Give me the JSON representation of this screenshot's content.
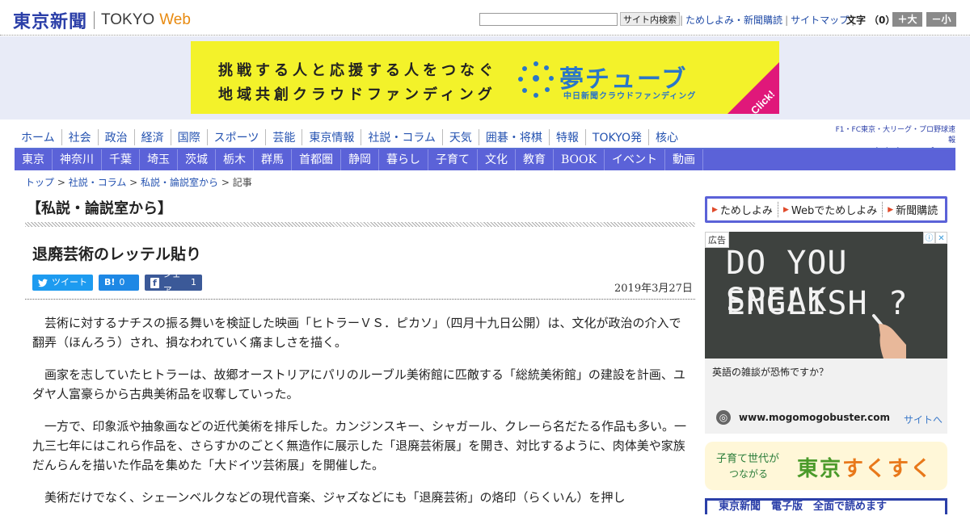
{
  "header": {
    "logo_jp": "東京新聞",
    "logo_en": "TOKYO",
    "logo_web": "Web",
    "search_button": "サイト内検索",
    "links": [
      "ためしよみ・新聞購読",
      "サイトマップ"
    ],
    "fontsize_label": "文字",
    "fontsize_count": "（0）",
    "enlarge": "＋大",
    "shrink": "－小"
  },
  "banner": {
    "line1": "挑戦する人と応援する人をつなぐ",
    "line2": "地域共創クラウドファンディング",
    "title": "夢チューブ",
    "subtitle": "中日新聞クラウドファンディング",
    "click": "Click!",
    "color_bg": "#f3f22a",
    "color_accent": "#2a76c8",
    "color_corner": "#e0187a"
  },
  "nav_primary": [
    "ホーム",
    "社会",
    "政治",
    "経済",
    "国際",
    "スポーツ",
    "芸能",
    "東京情報",
    "社説・コラム",
    "天気",
    "囲碁・将棋",
    "特報",
    "TOKYO発",
    "核心"
  ],
  "chunichi": {
    "tagline": "F1・FC東京・大リーグ・プロ野球速報",
    "logo": "東京中日スポーツ"
  },
  "nav_secondary": [
    "東京",
    "神奈川",
    "千葉",
    "埼玉",
    "茨城",
    "栃木",
    "群馬",
    "首都圏",
    "静岡",
    "暮らし",
    "子育て",
    "文化",
    "教育",
    "BOOK",
    "イベント",
    "動画"
  ],
  "breadcrumb": {
    "items": [
      "トップ",
      "社説・コラム",
      "私説・論説室から"
    ],
    "current": "記事",
    "sep": " > "
  },
  "article": {
    "section": "【私説・論説室から】",
    "title": "退廃芸術のレッテル貼り",
    "share": {
      "tweet": "ツイート",
      "hatena_glyph": "B!",
      "hatena_count": "0",
      "fb_glyph": "f",
      "fb_label": "シェア",
      "fb_count": "1"
    },
    "date": "2019年3月27日",
    "paragraphs": [
      "芸術に対するナチスの振る舞いを検証した映画「ヒトラーＶＳ．ピカソ」（四月十九日公開）は、文化が政治の介入で翻弄（ほんろう）され、損なわれていく痛ましさを描く。",
      "画家を志していたヒトラーは、故郷オーストリアにパリのルーブル美術館に匹敵する「総統美術館」の建設を計画、ユダヤ人富豪らから古典美術品を収奪していった。",
      "一方で、印象派や抽象画などの近代美術を排斥した。カンジンスキー、シャガール、クレーら名だたる作品も多い。一九三七年にはこれら作品を、さらすかのごとく無造作に展示した「退廃芸術展」を開き、対比するように、肉体美や家族だんらんを描いた作品を集めた「大ドイツ芸術展」を開催した。",
      "美術だけでなく、シェーンベルクなどの現代音楽、ジャズなどにも「退廃芸術」の烙印（らくいん）を押し"
    ]
  },
  "sidebar": {
    "subscribe": [
      "ためしよみ",
      "Webでためしよみ",
      "新聞購読"
    ],
    "ad": {
      "label": "広告",
      "chalk_line1": "DO YOU SPEAK",
      "chalk_line2": "ENGLISH ?",
      "question": "英語の雑談が恐怖ですか？",
      "url": "www.mogomogobuster.com",
      "link": "サイトへ",
      "info_glyphs": [
        "ⓘ",
        "✕"
      ]
    },
    "sukusuku": {
      "line1": "子育て世代が",
      "line2": "つながる",
      "title_a": "東京",
      "title_b": "すくすく"
    },
    "bottom_ad": "東京新聞　電子版　全面で読めます"
  }
}
